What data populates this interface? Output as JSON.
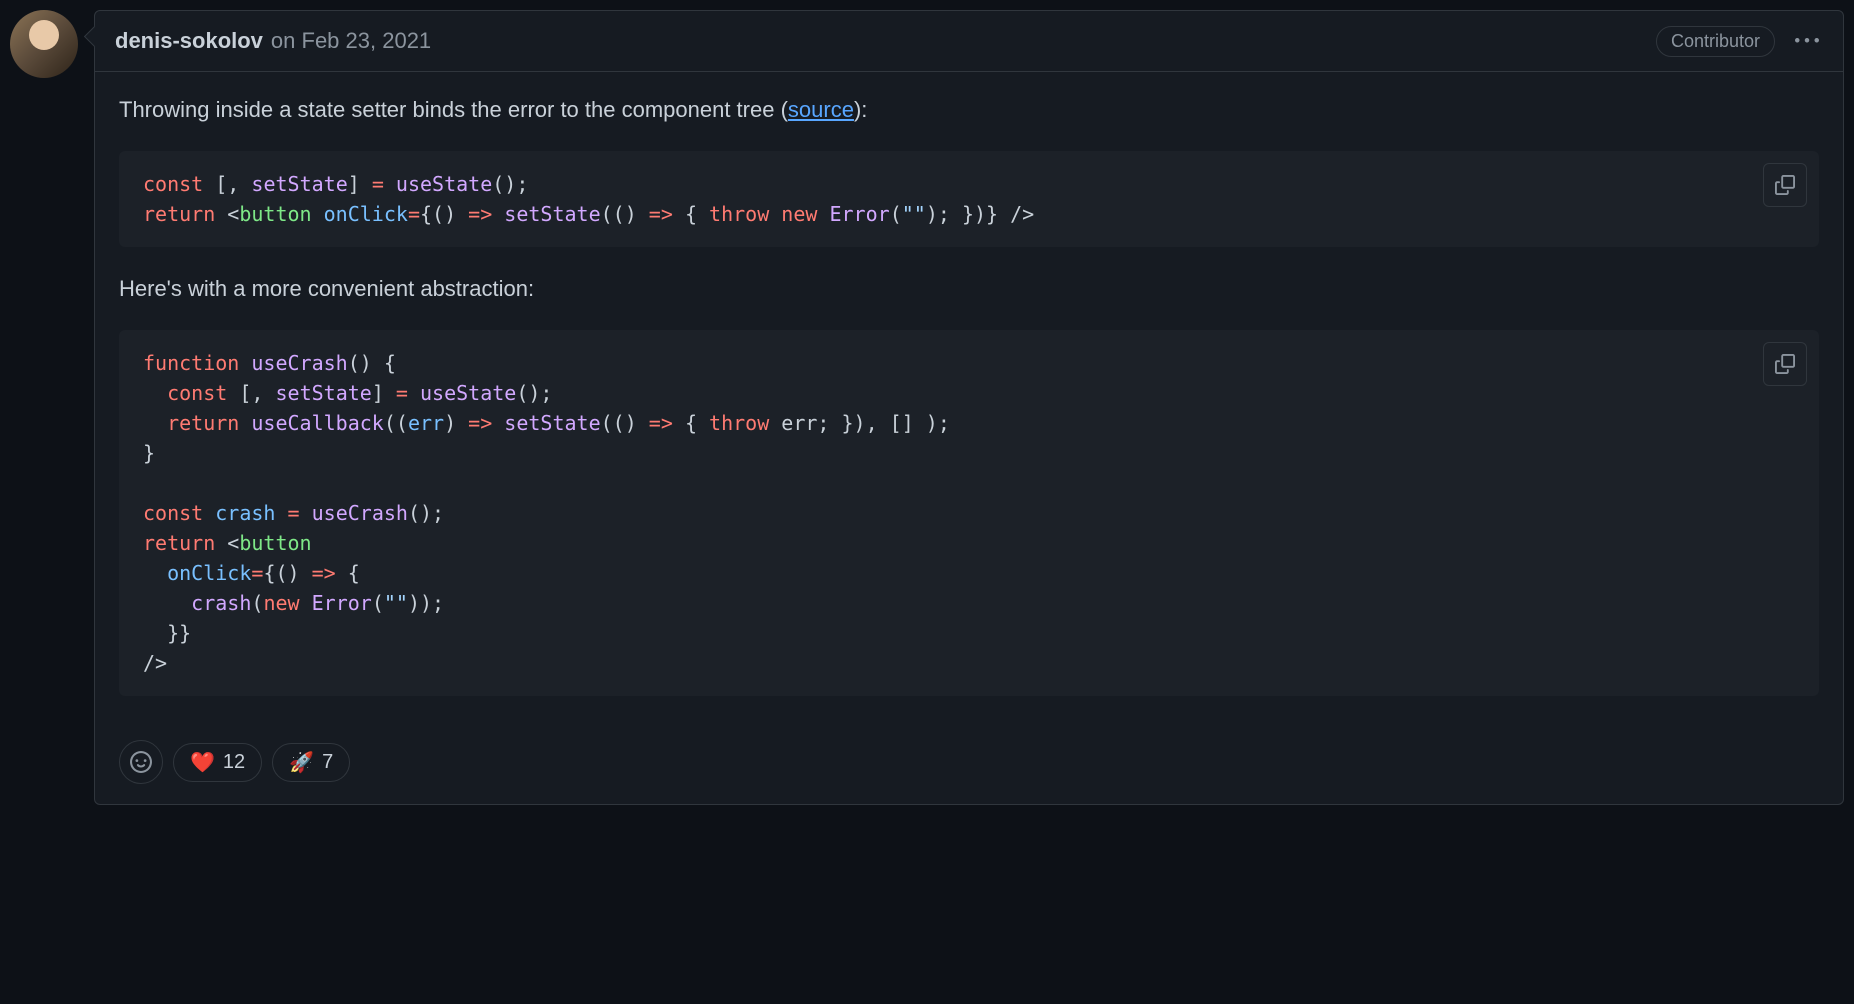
{
  "comment": {
    "author": "denis-sokolov",
    "timestamp": "on Feb 23, 2021",
    "badge": "Contributor",
    "body": {
      "p1_prefix": "Throwing inside a state setter binds the error to the component tree (",
      "p1_link": "source",
      "p1_suffix": "):",
      "p2": "Here's with a more convenient abstraction:"
    },
    "code1": {
      "raw": "const [, setState] = useState();\nreturn <button onClick={() => setState(() => { throw new Error(\"\"); })} />"
    },
    "code2": {
      "raw": "function useCrash() {\n  const [, setState] = useState();\n  return useCallback((err) => setState(() => { throw err; }), [] );\n}\n\nconst crash = useCrash();\nreturn <button\n  onClick={() => {\n    crash(new Error(\"\"));\n  }}\n/>"
    },
    "reactions": [
      {
        "emoji": "❤️",
        "count": "12"
      },
      {
        "emoji": "🚀",
        "count": "7"
      }
    ]
  }
}
